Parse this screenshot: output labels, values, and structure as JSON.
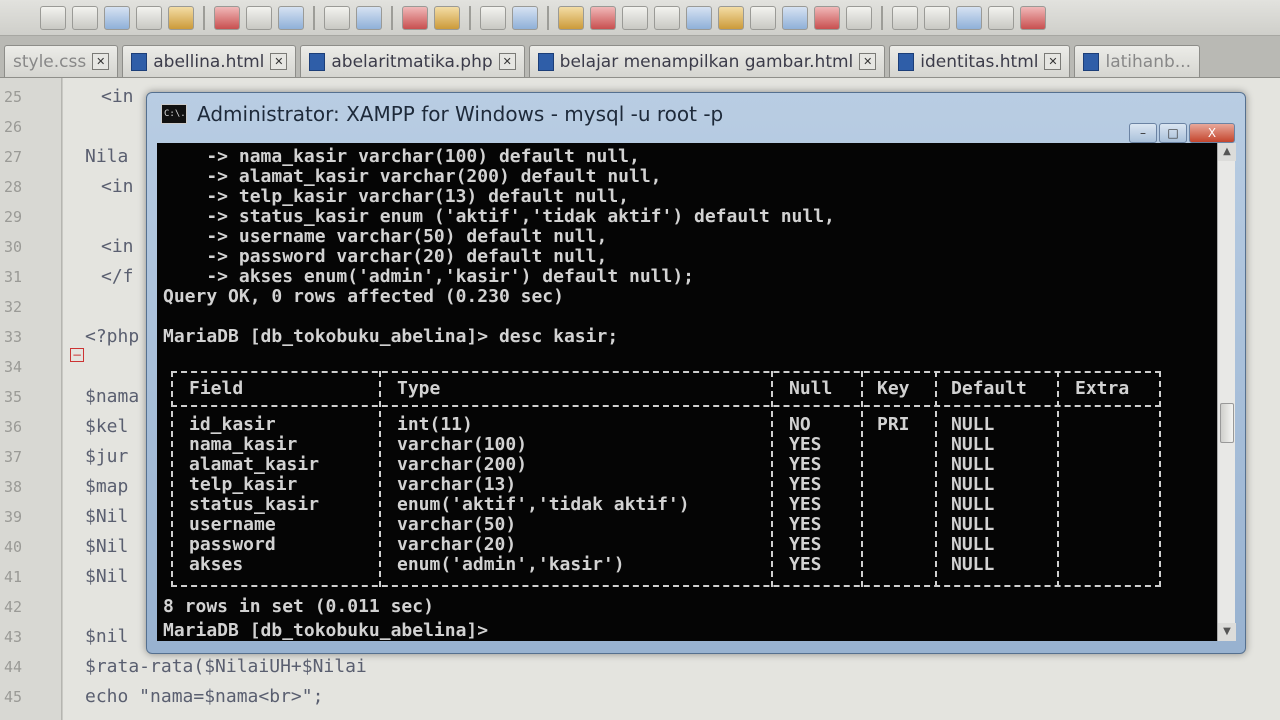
{
  "tabs": [
    {
      "label": "style.css",
      "kind": "css"
    },
    {
      "label": "abellina.html",
      "kind": "html"
    },
    {
      "label": "abelaritmatika.php",
      "kind": "php"
    },
    {
      "label": "belajar menampilkan gambar.html",
      "kind": "html"
    },
    {
      "label": "identitas.html",
      "kind": "html"
    },
    {
      "label": "latihanb...",
      "kind": "html"
    }
  ],
  "tab_close_glyph": "✕",
  "gutter": [
    "25",
    "26",
    "27",
    "28",
    "29",
    "30",
    "31",
    "32",
    "33",
    "34",
    "35",
    "36",
    "37",
    "38",
    "39",
    "40",
    "41",
    "42",
    "43",
    "44",
    "45"
  ],
  "editor_code": [
    "<in",
    "",
    "Nila",
    "<in",
    "",
    "<in",
    "</f",
    "",
    "<?php",
    "",
    "$nama",
    "$kel",
    "$jur",
    "$map",
    "$Nil",
    "$Nil",
    "$Nil",
    "",
    "$nil",
    "$rata-rata($NilaiUH+$Nilai",
    "echo \"nama=$nama<br>\";"
  ],
  "window": {
    "title": "Administrator:  XAMPP for Windows - mysql  -u root -p",
    "icon_text": "C:\\.",
    "controls": {
      "minimize": "–",
      "maximize": "□",
      "close": "X"
    }
  },
  "console": {
    "create_lines": [
      "    -> nama_kasir varchar(100) default null,",
      "    -> alamat_kasir varchar(200) default null,",
      "    -> telp_kasir varchar(13) default null,",
      "    -> status_kasir enum ('aktif','tidak aktif') default null,",
      "    -> username varchar(50) default null,",
      "    -> password varchar(20) default null,",
      "    -> akses enum('admin','kasir') default null);"
    ],
    "query_ok": "Query OK, 0 rows affected (0.230 sec)",
    "prompt_desc": "MariaDB [db_tokobuku_abelina]> desc kasir;",
    "table": {
      "headers": [
        "Field",
        "Type",
        "Null",
        "Key",
        "Default",
        "Extra"
      ],
      "rows": [
        [
          "id_kasir",
          "int(11)",
          "NO",
          "PRI",
          "NULL",
          ""
        ],
        [
          "nama_kasir",
          "varchar(100)",
          "YES",
          "",
          "NULL",
          ""
        ],
        [
          "alamat_kasir",
          "varchar(200)",
          "YES",
          "",
          "NULL",
          ""
        ],
        [
          "telp_kasir",
          "varchar(13)",
          "YES",
          "",
          "NULL",
          ""
        ],
        [
          "status_kasir",
          "enum('aktif','tidak aktif')",
          "YES",
          "",
          "NULL",
          ""
        ],
        [
          "username",
          "varchar(50)",
          "YES",
          "",
          "NULL",
          ""
        ],
        [
          "password",
          "varchar(20)",
          "YES",
          "",
          "NULL",
          ""
        ],
        [
          "akses",
          "enum('admin','kasir')",
          "YES",
          "",
          "NULL",
          ""
        ]
      ]
    },
    "rows_in_set": "8 rows in set (0.011 sec)",
    "prompt_end": "MariaDB [db_tokobuku_abelina]>"
  }
}
